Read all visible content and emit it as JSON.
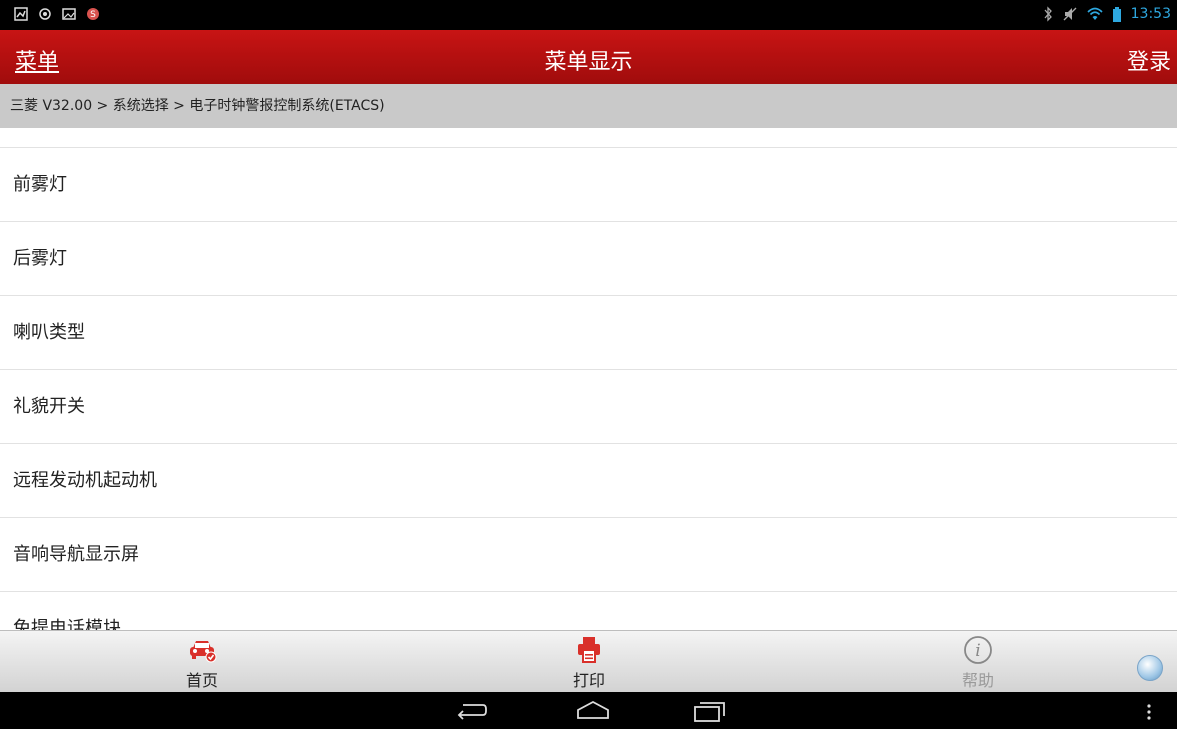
{
  "status_bar": {
    "time": "13:53",
    "left_icons": [
      "notification-icon",
      "location-icon",
      "image-icon",
      "app-icon"
    ],
    "right_icons": [
      "bluetooth-icon",
      "mute-icon",
      "wifi-icon",
      "battery-icon"
    ]
  },
  "header": {
    "menu_label": "菜单",
    "title": "菜单显示",
    "login_label": "登录"
  },
  "breadcrumb": "三菱 V32.00 > 系统选择 > 电子时钟警报控制系统(ETACS)",
  "menu_items": [
    {
      "label": "前雾灯"
    },
    {
      "label": "后雾灯"
    },
    {
      "label": "喇叭类型"
    },
    {
      "label": "礼貌开关"
    },
    {
      "label": "远程发动机起动机"
    },
    {
      "label": "音响导航显示屏"
    },
    {
      "label": "免提电话模块"
    }
  ],
  "bottom_toolbar": {
    "home_label": "首页",
    "print_label": "打印",
    "help_label": "帮助"
  },
  "colors": {
    "header_red": "#b40f0f",
    "breadcrumb_gray": "#c9c9c9",
    "accent_blue": "#2ea8e0"
  }
}
